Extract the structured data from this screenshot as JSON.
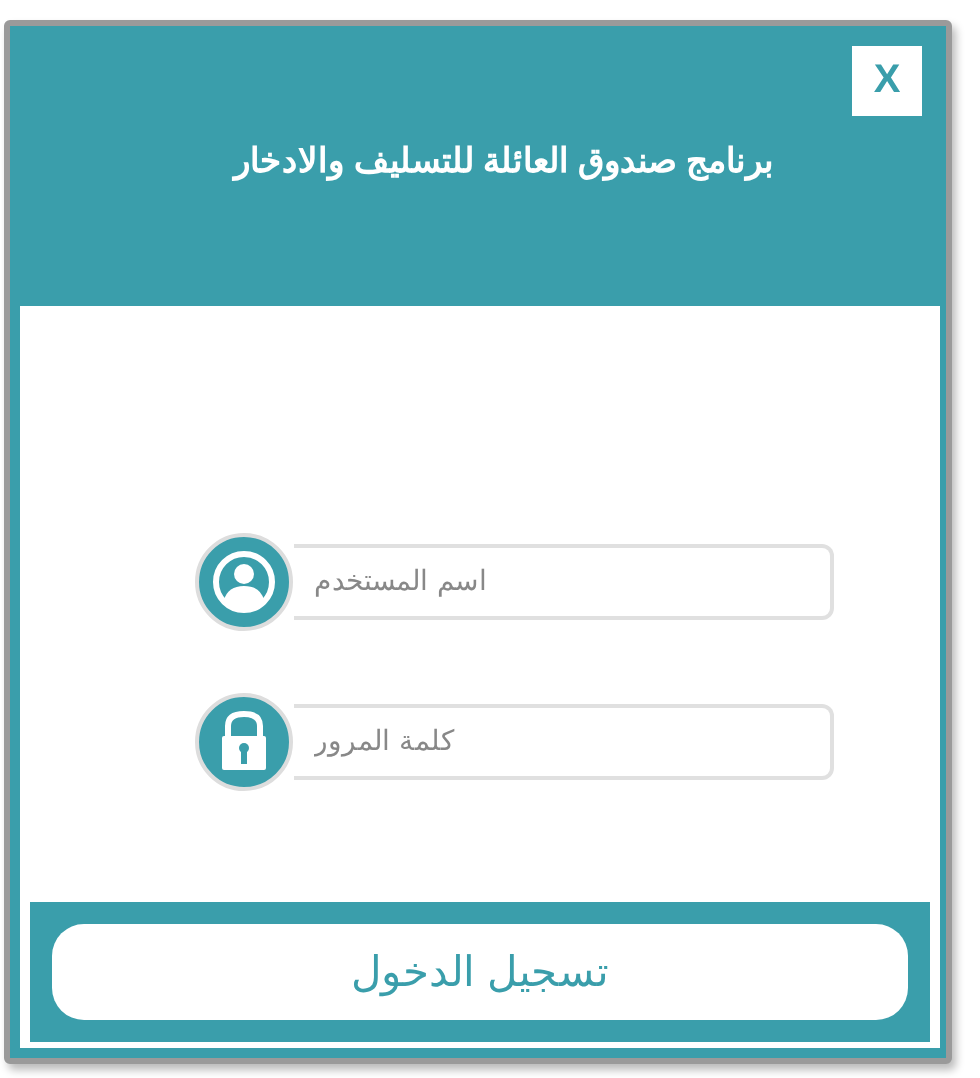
{
  "window": {
    "title": "برنامج صندوق العائلة للتسليف والادخار",
    "close": "X"
  },
  "fields": [
    {
      "kind": "user",
      "placeholder": "اسم المستخدم"
    },
    {
      "kind": "lock",
      "placeholder": "كلمة المرور"
    }
  ],
  "login_button": "تسجيل الدخول"
}
